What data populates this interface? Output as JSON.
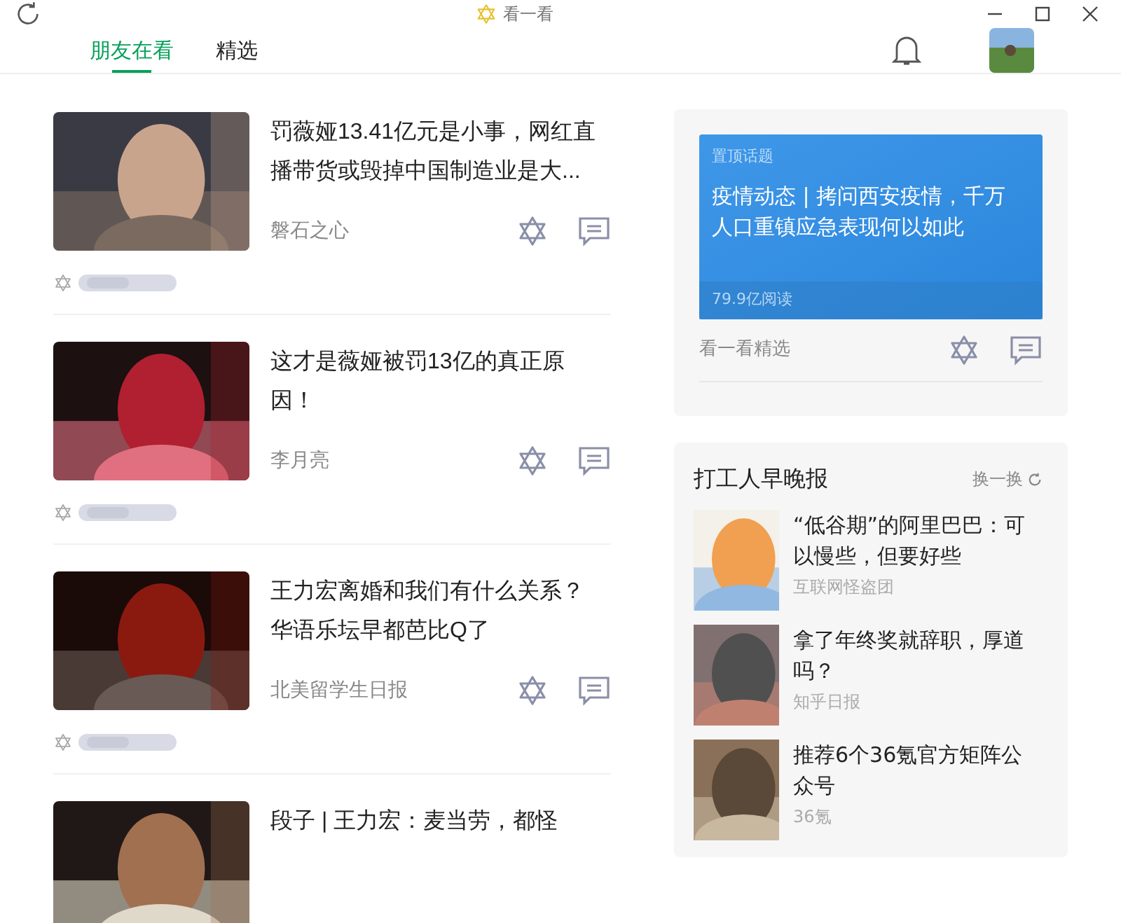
{
  "window": {
    "title": "看一看"
  },
  "tabs": [
    {
      "label": "朋友在看",
      "selected": true
    },
    {
      "label": "精选",
      "selected": false
    }
  ],
  "feed": [
    {
      "title": "罚薇娅13.41亿元是小事，网红直播带货或毁掉中国制造业是大...",
      "source": "磐石之心"
    },
    {
      "title": "这才是薇娅被罚13亿的真正原因！",
      "source": "李月亮"
    },
    {
      "title": "王力宏离婚和我们有什么关系？华语乐坛早都芭比Q了",
      "source": "北美留学生日报"
    },
    {
      "title": "段子 | 王力宏：麦当劳，都怪"
    }
  ],
  "pinned": {
    "tag": "置顶话题",
    "headline": "疫情动态 | 拷问西安疫情，千万人口重镇应急表现何以如此",
    "reads": "79.9亿阅读",
    "source": "看一看精选"
  },
  "digest": {
    "title": "打工人早晚报",
    "refresh": "换一换",
    "items": [
      {
        "title": "“低谷期”的阿里巴巴：可以慢些，但要好些",
        "source": "互联网怪盗团"
      },
      {
        "title": "拿了年终奖就辞职，厚道吗？",
        "source": "知乎日报"
      },
      {
        "title": "推荐6个36氪官方矩阵公众号",
        "source": "36氪"
      }
    ]
  }
}
